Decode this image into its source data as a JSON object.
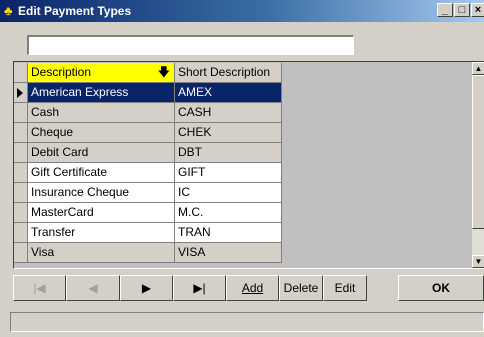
{
  "window": {
    "title": "Edit Payment Types",
    "icon": "payment-app-icon",
    "controls": {
      "minimize": "_",
      "maximize": "□",
      "close": "×"
    }
  },
  "search": {
    "value": "",
    "placeholder": ""
  },
  "grid": {
    "columns": [
      "Description",
      "Short Description"
    ],
    "sort_icon": "arrow-down-icon",
    "rows": [
      {
        "description": "American Express",
        "short": "AMEX",
        "state": "selected"
      },
      {
        "description": "Cash",
        "short": "CASH",
        "state": "gray"
      },
      {
        "description": "Cheque",
        "short": "CHEK",
        "state": "gray"
      },
      {
        "description": "Debit Card",
        "short": "DBT",
        "state": "gray"
      },
      {
        "description": "Gift Certificate",
        "short": "GIFT",
        "state": "white"
      },
      {
        "description": "Insurance Cheque",
        "short": "IC",
        "state": "white"
      },
      {
        "description": "MasterCard",
        "short": "M.C.",
        "state": "white"
      },
      {
        "description": "Transfer",
        "short": "TRAN",
        "state": "white"
      },
      {
        "description": "Visa",
        "short": "VISA",
        "state": "gray"
      }
    ]
  },
  "nav": {
    "first": "|◀",
    "prev": "◀",
    "next": "▶",
    "last": "▶|",
    "add": "Add",
    "delete": "Delete",
    "edit": "Edit",
    "ok": "OK"
  },
  "colors": {
    "titlebar": "#0a246a",
    "header_highlight": "#ffff00",
    "selection": "#0a246a"
  }
}
